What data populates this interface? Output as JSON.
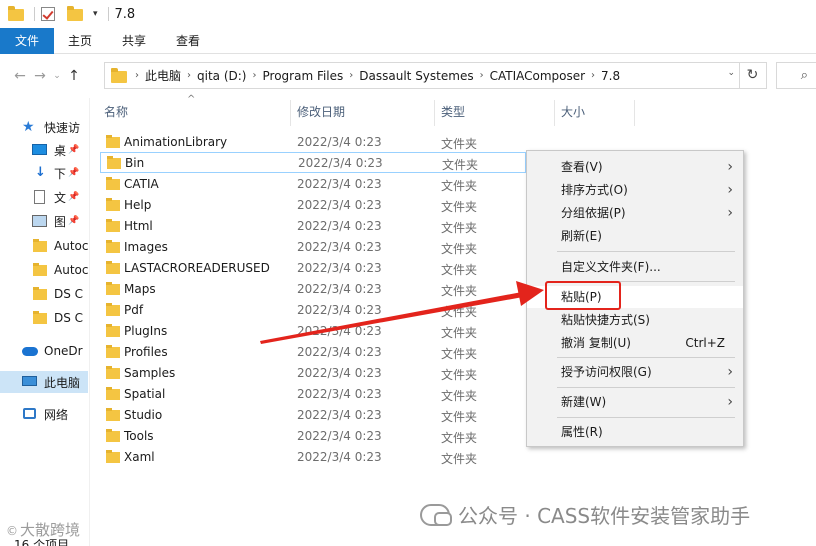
{
  "window": {
    "title": "7.8"
  },
  "ribbon": {
    "tabs": [
      "文件",
      "主页",
      "共享",
      "查看"
    ]
  },
  "address": {
    "crumbs": [
      "此电脑",
      "qita (D:)",
      "Program Files",
      "Dassault Systemes",
      "CATIAComposer",
      "7.8"
    ]
  },
  "nav": {
    "items": [
      {
        "label": "快速访",
        "icon": "star-icon"
      },
      {
        "label": "桌",
        "icon": "desktop-icon",
        "pinned": true
      },
      {
        "label": "下",
        "icon": "download-icon",
        "pinned": true
      },
      {
        "label": "文",
        "icon": "document-icon",
        "pinned": true
      },
      {
        "label": "图",
        "icon": "picture-icon",
        "pinned": true
      },
      {
        "label": "Autoc",
        "icon": "folder-icon"
      },
      {
        "label": "Autoc",
        "icon": "folder-icon"
      },
      {
        "label": "DS C",
        "icon": "folder-icon"
      },
      {
        "label": "DS C",
        "icon": "folder-icon"
      },
      {
        "label": "OneDr",
        "icon": "onedrive-icon"
      },
      {
        "label": "此电脑",
        "icon": "computer-icon",
        "selected": true
      },
      {
        "label": "网络",
        "icon": "network-icon"
      }
    ]
  },
  "columns": {
    "name": "名称",
    "date": "修改日期",
    "type": "类型",
    "size": "大小"
  },
  "files": [
    {
      "name": "AnimationLibrary",
      "date": "2022/3/4 0:23",
      "type": "文件夹"
    },
    {
      "name": "Bin",
      "date": "2022/3/4 0:23",
      "type": "文件夹"
    },
    {
      "name": "CATIA",
      "date": "2022/3/4 0:23",
      "type": "文件夹"
    },
    {
      "name": "Help",
      "date": "2022/3/4 0:23",
      "type": "文件夹"
    },
    {
      "name": "Html",
      "date": "2022/3/4 0:23",
      "type": "文件夹"
    },
    {
      "name": "Images",
      "date": "2022/3/4 0:23",
      "type": "文件夹"
    },
    {
      "name": "LASTACROREADERUSED",
      "date": "2022/3/4 0:23",
      "type": "文件夹"
    },
    {
      "name": "Maps",
      "date": "2022/3/4 0:23",
      "type": "文件夹"
    },
    {
      "name": "Pdf",
      "date": "2022/3/4 0:23",
      "type": "文件夹"
    },
    {
      "name": "PlugIns",
      "date": "2022/3/4 0:23",
      "type": "文件夹"
    },
    {
      "name": "Profiles",
      "date": "2022/3/4 0:23",
      "type": "文件夹"
    },
    {
      "name": "Samples",
      "date": "2022/3/4 0:23",
      "type": "文件夹"
    },
    {
      "name": "Spatial",
      "date": "2022/3/4 0:23",
      "type": "文件夹"
    },
    {
      "name": "Studio",
      "date": "2022/3/4 0:23",
      "type": "文件夹"
    },
    {
      "name": "Tools",
      "date": "2022/3/4 0:23",
      "type": "文件夹"
    },
    {
      "name": "Xaml",
      "date": "2022/3/4 0:23",
      "type": "文件夹"
    }
  ],
  "context_menu": {
    "items": [
      {
        "label": "查看(V)",
        "submenu": true
      },
      {
        "label": "排序方式(O)",
        "submenu": true
      },
      {
        "label": "分组依据(P)",
        "submenu": true
      },
      {
        "label": "刷新(E)"
      },
      {
        "label": "自定义文件夹(F)..."
      },
      {
        "label": "粘贴(P)",
        "highlighted": true
      },
      {
        "label": "粘贴快捷方式(S)"
      },
      {
        "label": "撤消 复制(U)",
        "shortcut": "Ctrl+Z"
      },
      {
        "label": "授予访问权限(G)",
        "submenu": true
      },
      {
        "label": "新建(W)",
        "submenu": true
      },
      {
        "label": "属性(R)"
      }
    ]
  },
  "status": {
    "count": "16 个项目"
  },
  "watermark": {
    "right": "公众号 · CASS软件安装管家助手",
    "left": "大散跨境"
  },
  "colors": {
    "accent": "#1979ca",
    "selection": "#cce4f7",
    "annotation": "#e3241c",
    "folder": "#f4c542"
  }
}
